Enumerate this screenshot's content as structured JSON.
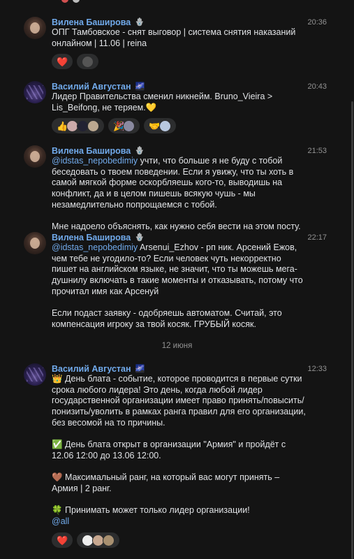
{
  "messages": [
    {
      "author": "Вилена Баширова",
      "badge_icon": "sticker-badge-icon",
      "time": "20:36",
      "text": "ОПГ Тамбовское - снят выговор | система снятия наказаний онлайном | 11.06 | reina",
      "reactions": [
        "heart",
        "avatar-dark"
      ]
    },
    {
      "author": "Василий Августан",
      "badge_icon": "sparkle-badge-icon",
      "time": "20:43",
      "text": "Лидер Правительства сменил никнейм. Bruno_Vieira > Lis_Beifong, не теряем.💛",
      "reactions": [
        "thumbs-up-group",
        "party-group",
        "handshake-group"
      ]
    },
    {
      "author": "Вилена Баширова",
      "badge_icon": "sticker-badge-icon",
      "time": "21:53",
      "mention": "@idstas_nepobedimiy",
      "text": " учти, что больше я не буду с тобой беседовать о твоем поведении. Если я увижу, что ты хоть в самой мягкой форме оскорбляешь кого-то, выводишь на конфликт, да и в целом пишешь всякую чушь - мы незамедлительно попрощаемся с тобой.\n\nМне надоело объяснять, как нужно себя вести на этом посту."
    },
    {
      "author": "Вилена Баширова",
      "badge_icon": "sticker-badge-icon",
      "time": "22:17",
      "mention": "@idstas_nepobedimiy",
      "text": " Arsenui_Ezhov - рп ник. Арсений Ежов, чем тебе не угодило-то? Если человек чуть некорректно пишет на английском языке, не значит, что ты можешь мега-душнилу включать в такие моменты и отказывать, потому что прочитал имя как Арсенуй\n\nЕсли подаст заявку - одобряешь автоматом. Считай, это компенсация игроку за твой косяк. ГРУБЫЙ косяк."
    },
    {
      "author": "Василий Августан",
      "badge_icon": "sparkle-badge-icon",
      "time": "12:33",
      "text": "👑 День блата - событие, которое проводится в первые сутки срока любого лидера! Это день, когда любой лидер государственной организации имеет право принять/повысить/понизить/уволить в рамках ранга правил для его организации, без весомой на то причины.\n\n✅ День блата открыт в организации \"Армия\" и пройдёт с 12.06 12:00 до 13.06 12:00.\n\n🤎 Максимальный ранг, на который вас могут принять – Армия | 2 ранг.\n\n🍀 Принимать может только лидер организации!",
      "mention_after": "@all",
      "reactions": [
        "heart",
        "avatar-group"
      ]
    }
  ],
  "date_separator": "12 июня"
}
